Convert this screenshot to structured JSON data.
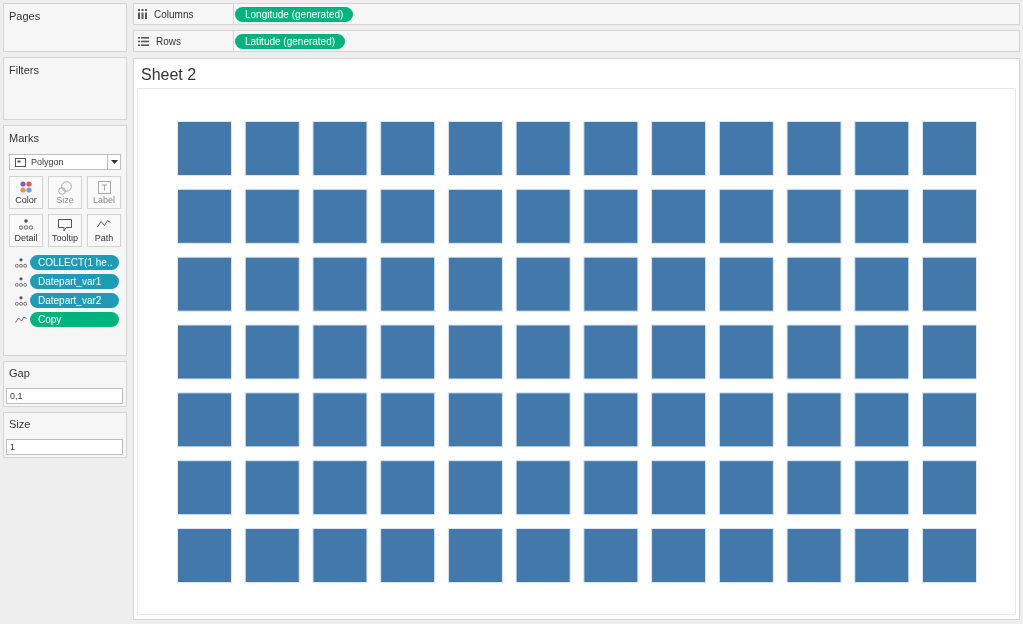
{
  "pages_card": {
    "title": "Pages"
  },
  "filters_card": {
    "title": "Filters"
  },
  "marks_card": {
    "title": "Marks",
    "mark_type": "Polygon",
    "properties": [
      {
        "label": "Color",
        "kind": "color",
        "disabled": false
      },
      {
        "label": "Size",
        "kind": "size",
        "disabled": true
      },
      {
        "label": "Label",
        "kind": "label",
        "disabled": true
      },
      {
        "label": "Detail",
        "kind": "detail",
        "disabled": false
      },
      {
        "label": "Tooltip",
        "kind": "tooltip",
        "disabled": false
      },
      {
        "label": "Path",
        "kind": "path",
        "disabled": false
      }
    ],
    "fields": [
      {
        "label": "COLLECT(1 he..",
        "kind": "detail",
        "color": "#1f9bb5"
      },
      {
        "label": "Datepart_var1",
        "kind": "detail",
        "color": "#1f9bb5"
      },
      {
        "label": "Datepart_var2",
        "kind": "detail",
        "color": "#1f9bb5"
      },
      {
        "label": "Copy",
        "kind": "path",
        "color": "#00b37d"
      }
    ]
  },
  "parameters": [
    {
      "title": "Gap",
      "value": "0,1"
    },
    {
      "title": "Size",
      "value": "1"
    }
  ],
  "shelves": [
    {
      "label": "Columns",
      "kind": "columns",
      "pills": [
        "Longitude (generated)"
      ]
    },
    {
      "label": "Rows",
      "kind": "rows",
      "pills": [
        "Latitude (generated)"
      ]
    }
  ],
  "sheet": {
    "title": "Sheet 2"
  }
}
